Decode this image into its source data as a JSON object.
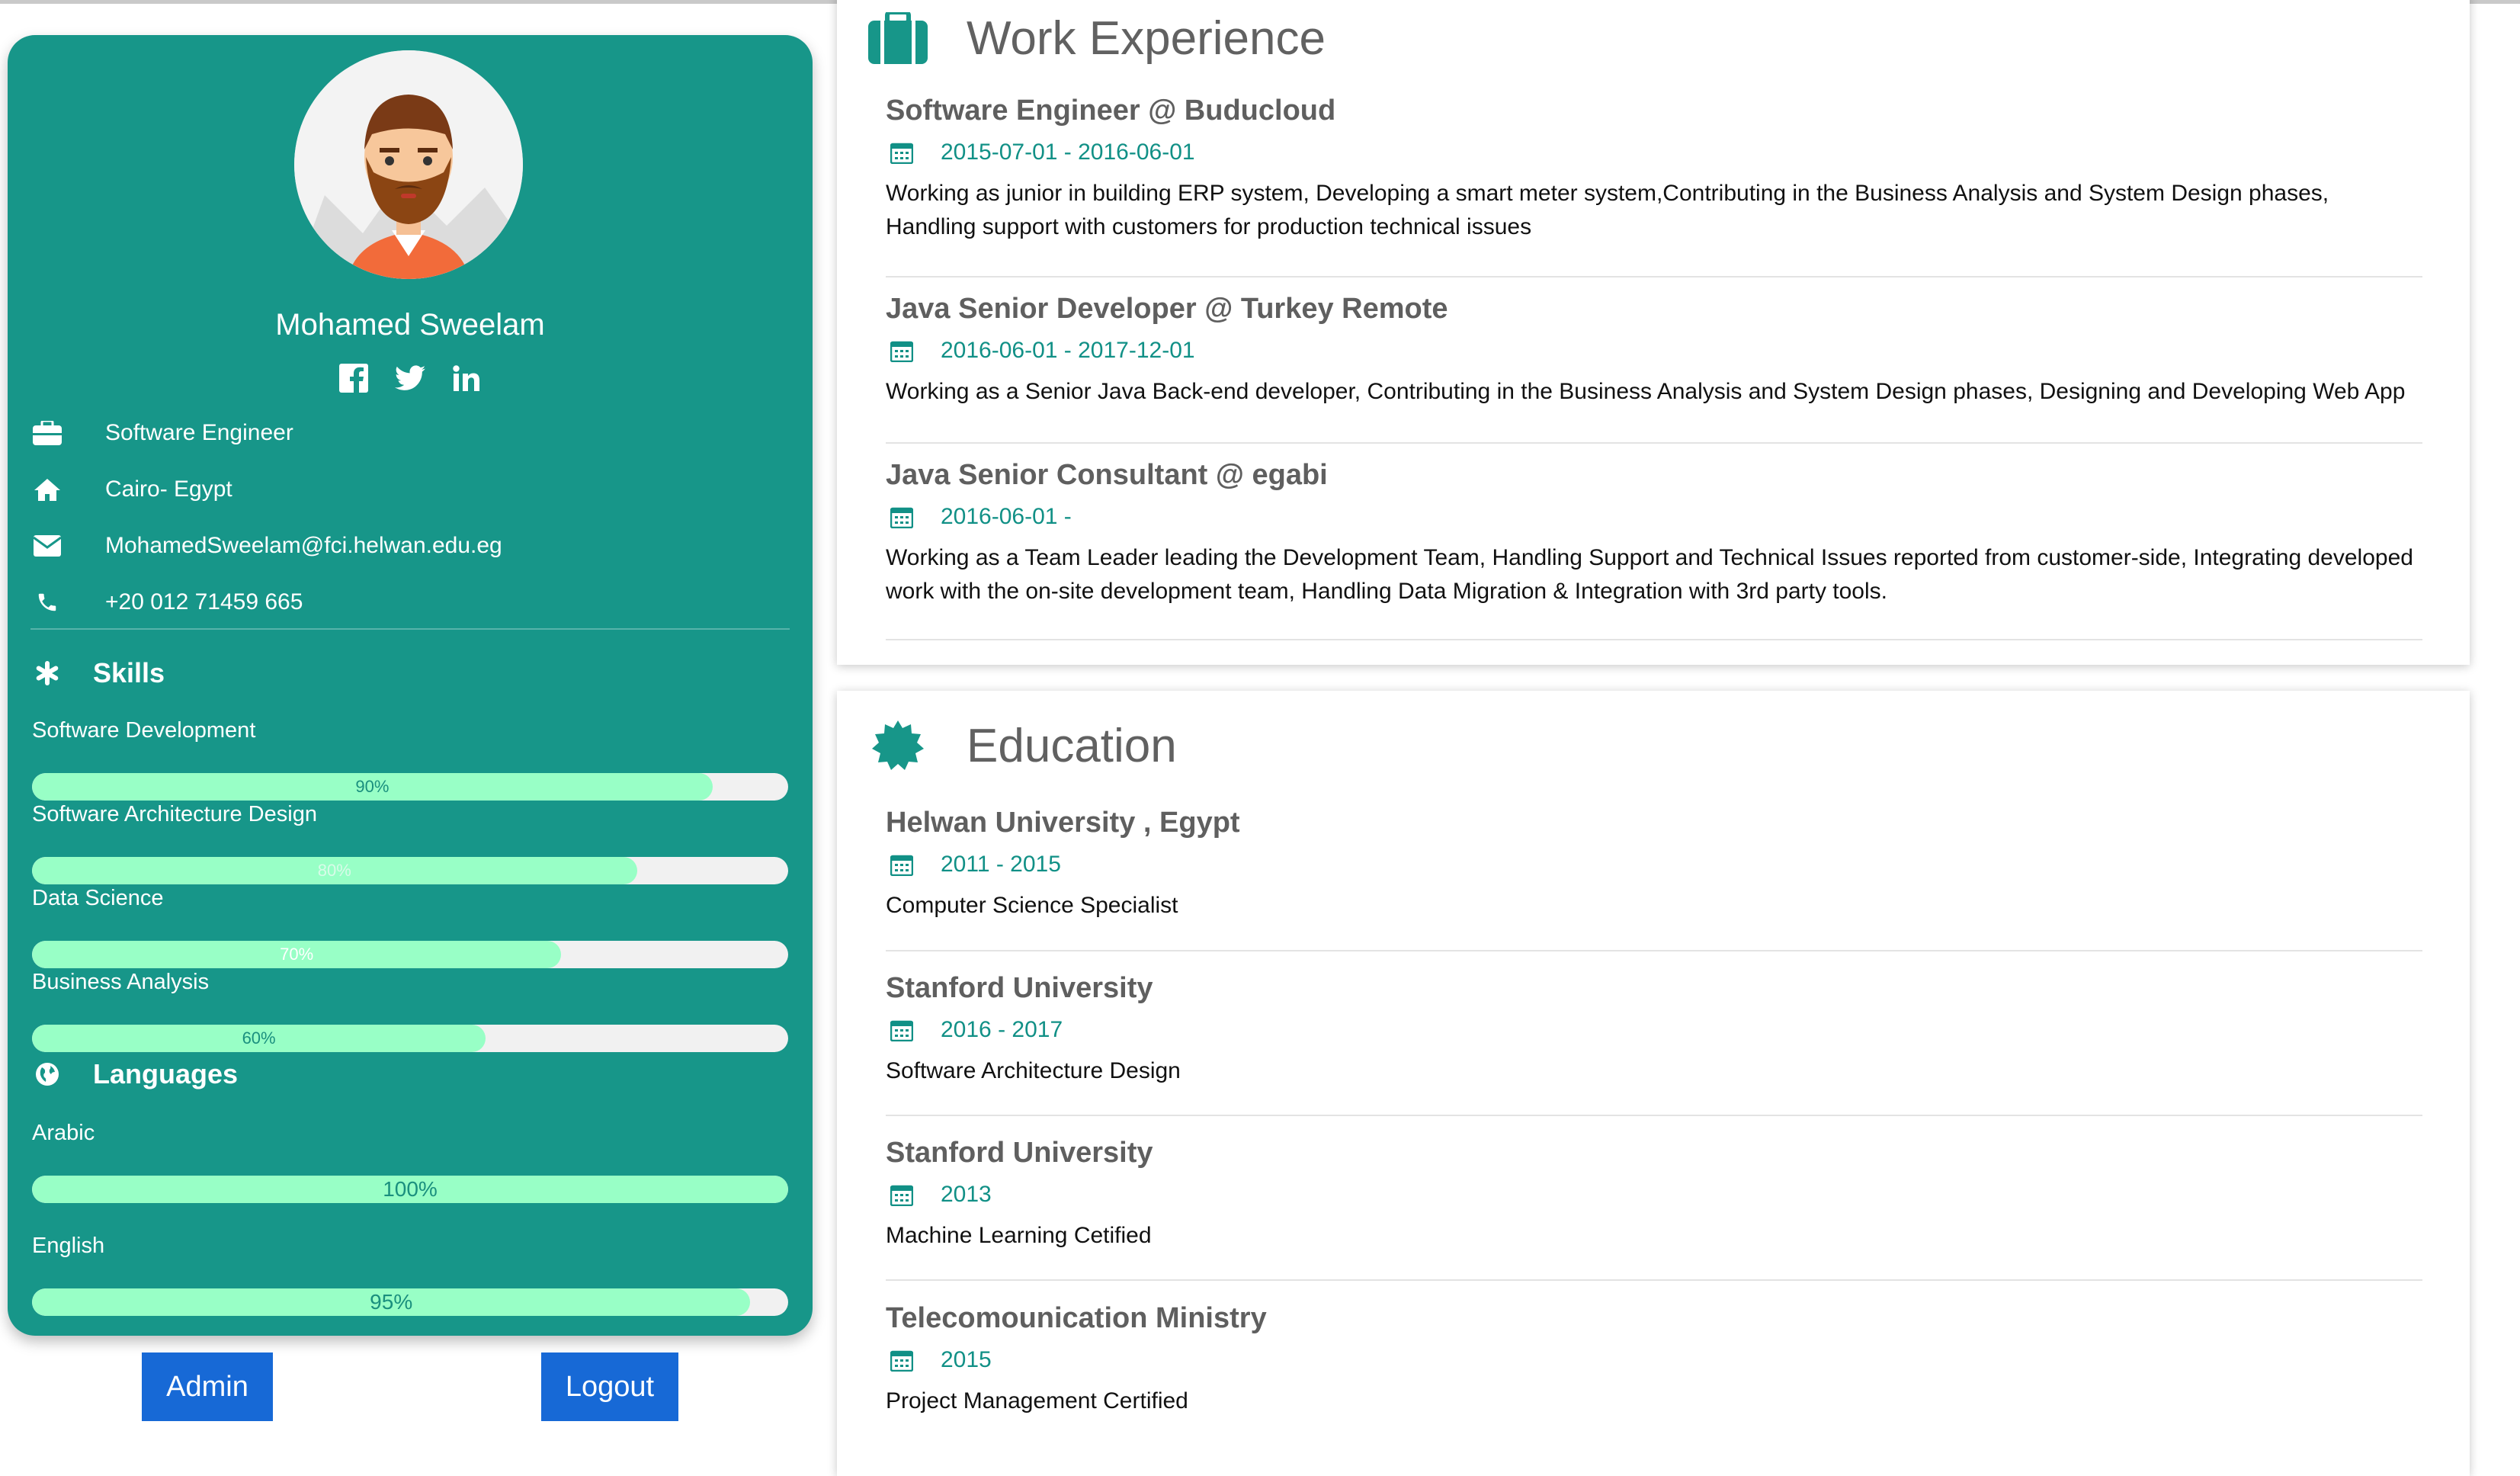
{
  "profile": {
    "name": "Mohamed Sweelam",
    "details": [
      {
        "icon": "briefcase-icon",
        "text": "Software Engineer"
      },
      {
        "icon": "home-icon",
        "text": "Cairo- Egypt"
      },
      {
        "icon": "envelope-icon",
        "text": "MohamedSweelam@fci.helwan.edu.eg"
      },
      {
        "icon": "phone-icon",
        "text": "+20 012 71459 665"
      }
    ],
    "social": [
      "facebook-icon",
      "twitter-icon",
      "linkedin-icon"
    ]
  },
  "skills": {
    "heading": "Skills",
    "items": [
      {
        "label": "Software Development",
        "percent": 90,
        "percent_label": "90%"
      },
      {
        "label": "Software Architecture Design",
        "percent": 80,
        "percent_label": "80%"
      },
      {
        "label": "Data Science",
        "percent": 70,
        "percent_label": "70%"
      },
      {
        "label": "Business Analysis",
        "percent": 60,
        "percent_label": "60%"
      }
    ]
  },
  "languages": {
    "heading": "Languages",
    "items": [
      {
        "label": "Arabic",
        "percent": 100,
        "percent_label": "100%"
      },
      {
        "label": "English",
        "percent": 95,
        "percent_label": "95%"
      }
    ]
  },
  "buttons": {
    "admin": "Admin",
    "logout": "Logout"
  },
  "work": {
    "heading": "Work Experience",
    "entries": [
      {
        "title": "Software Engineer @ Buducloud",
        "date": "2015-07-01 - 2016-06-01",
        "desc": "Working as junior in building ERP system, Developing a smart meter system,Contributing in the Business Analysis and System Design phases, Handling support with customers for production technical issues"
      },
      {
        "title": "Java Senior Developer @ Turkey Remote",
        "date": "2016-06-01 - 2017-12-01",
        "desc": "Working as a Senior Java Back-end developer, Contributing in the Business Analysis and System Design phases, Designing and Developing Web App"
      },
      {
        "title": "Java Senior Consultant @ egabi",
        "date": "2016-06-01 -",
        "desc": "Working as a Team Leader leading the Development Team, Handling Support and Technical Issues reported from customer-side, Integrating developed work with the on-site development team, Handling Data Migration & Integration with 3rd party tools."
      }
    ]
  },
  "education": {
    "heading": "Education",
    "entries": [
      {
        "title": "Helwan University , Egypt",
        "date": "2011 - 2015",
        "desc": "Computer Science Specialist"
      },
      {
        "title": "Stanford University",
        "date": "2016 - 2017",
        "desc": "Software Architecture Design"
      },
      {
        "title": "Stanford University",
        "date": "2013",
        "desc": "Machine Learning Cetified"
      },
      {
        "title": "Telecomounication Ministry",
        "date": "2015",
        "desc": "Project Management Certified"
      }
    ]
  },
  "colors": {
    "sidebar": "#179689",
    "bar_fill": "#98ffc6",
    "accent": "#119086",
    "button": "#1769d6"
  }
}
